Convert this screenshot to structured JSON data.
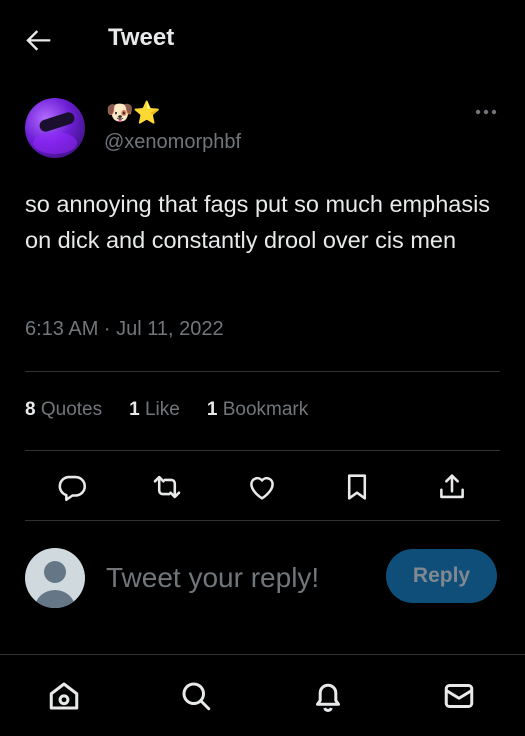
{
  "header": {
    "title": "Tweet"
  },
  "tweet": {
    "display_name_emoji": "🐶⭐",
    "handle": "@xenomorphbf",
    "text": "so annoying that fags put so much emphasis on dick and constantly drool over cis men",
    "timestamp": "6:13 AM · Jul 11, 2022"
  },
  "stats": {
    "quotes_count": "8",
    "quotes_label": "Quotes",
    "likes_count": "1",
    "likes_label": "Like",
    "bookmarks_count": "1",
    "bookmarks_label": "Bookmark"
  },
  "reply": {
    "placeholder": "Tweet your reply!",
    "button_label": "Reply"
  },
  "icons": {
    "back": "arrow-left-icon",
    "more": "more-horizontal-icon",
    "reply": "comment-icon",
    "retweet": "retweet-icon",
    "like": "heart-icon",
    "bookmark": "bookmark-icon",
    "share": "share-icon",
    "home": "home-icon",
    "search": "search-icon",
    "notifications": "bell-icon",
    "messages": "mail-icon"
  },
  "colors": {
    "background": "#000000",
    "text_primary": "#e7e9ea",
    "text_secondary": "#71767b",
    "divider": "#2f3336",
    "reply_button": "#0f4e78"
  }
}
